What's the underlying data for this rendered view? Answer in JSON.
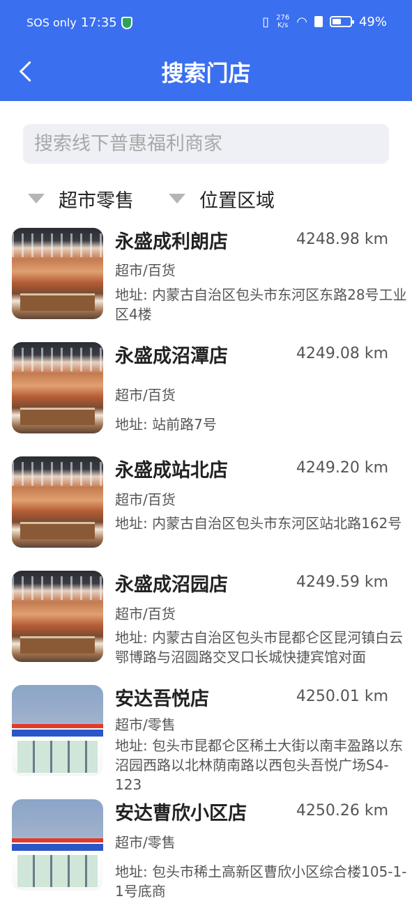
{
  "status_bar": {
    "sos": "SOS only",
    "time": "17:35",
    "speed_value": "276",
    "speed_unit": "K/s",
    "battery": "49%"
  },
  "header": {
    "title": "搜索门店"
  },
  "search": {
    "placeholder": "搜索线下普惠福利商家"
  },
  "filters": [
    {
      "label": "超市零售"
    },
    {
      "label": "位置区域"
    }
  ],
  "stores": [
    {
      "name": "永盛成利朗店",
      "distance": "4248.98 km",
      "category": "超市/百货",
      "address": "地址: 内蒙古自治区包头市东河区东路28号工业区4楼",
      "thumb": "supermarket"
    },
    {
      "name": "永盛成沼潭店",
      "distance": "4249.08 km",
      "category": "超市/百货",
      "address": "地址: 站前路7号",
      "thumb": "supermarket"
    },
    {
      "name": "永盛成站北店",
      "distance": "4249.20 km",
      "category": "超市/百货",
      "address": "地址: 内蒙古自治区包头市东河区站北路162号",
      "thumb": "supermarket"
    },
    {
      "name": "永盛成沼园店",
      "distance": "4249.59 km",
      "category": "超市/百货",
      "address": "地址: 内蒙古自治区包头市昆都仑区昆河镇白云鄂博路与沼圆路交叉口长城快捷宾馆对面",
      "thumb": "supermarket"
    },
    {
      "name": "安达吾悦店",
      "distance": "4250.01 km",
      "category": "超市/零售",
      "address": "地址: 包头市昆都仑区稀土大街以南丰盈路以东沼园西路以北林荫南路以西包头吾悦广场S4-123",
      "thumb": "convenience-store"
    },
    {
      "name": "安达曹欣小区店",
      "distance": "4250.26 km",
      "category": "超市/零售",
      "address": "地址: 包头市稀土高新区曹欣小区综合楼105-1-1号底商",
      "thumb": "convenience-store"
    }
  ]
}
